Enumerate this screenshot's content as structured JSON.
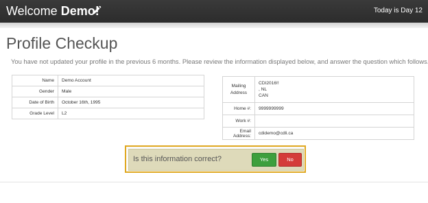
{
  "header": {
    "welcome_prefix": "Welcome",
    "user_name": "Demo!",
    "day_text": "Today is Day 12",
    "edit_icon": "pencil-icon"
  },
  "page": {
    "title": "Profile Checkup",
    "intro": "You have not updated your profile in the previous 6 months. Please review the information displayed below, and answer the question which follows."
  },
  "profile": {
    "name_label": "Name",
    "name_value": "Demo Account",
    "gender_label": "Gender",
    "gender_value": "Male",
    "dob_label": "Date of Birth",
    "dob_value": "October 16th, 1995",
    "grade_label": "Grade Level",
    "grade_value": "L2"
  },
  "contact": {
    "mailing_label": "Mailing Address",
    "address_lines": [
      "CDI2016!!",
      ", NL",
      "CAN"
    ],
    "home_label": "Home #:",
    "home_value": "9999999999",
    "work_label": "Work #:",
    "work_value": "",
    "email_label": "Email Address:",
    "email_value": "cdidemo@cdli.ca"
  },
  "confirm": {
    "question": "Is this information correct?",
    "yes_label": "Yes",
    "no_label": "No"
  },
  "colors": {
    "header_bg": "#2f2f2f",
    "confirm_border": "#e0a820",
    "confirm_bg": "#dedaba",
    "yes_button": "#3d9f3d",
    "no_button": "#d43c39"
  }
}
